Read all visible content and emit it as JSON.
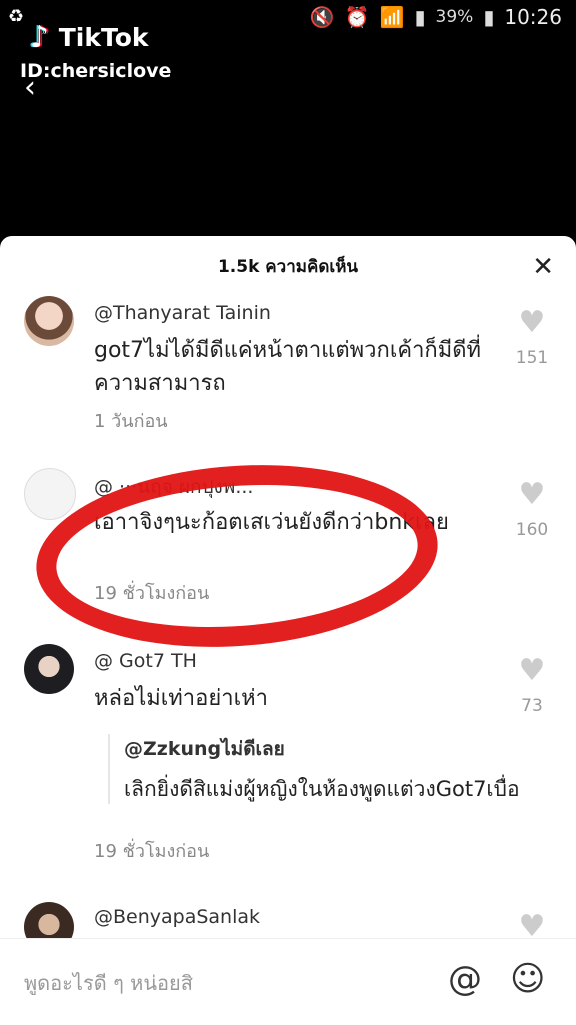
{
  "status": {
    "battery": "39%",
    "time": "10:26"
  },
  "watermark": {
    "app": "TikTok",
    "id": "ID:chersiclove"
  },
  "panel": {
    "title": "1.5k ความคิดเห็น"
  },
  "comments": [
    {
      "user": "@Thanyarat Tainin",
      "text": "got7ไม่ได้มีดีแค่หน้าตาแต่พวกเค้าก็มีดีที่ความสามารถ",
      "time": "1 วันก่อน",
      "likes": "151"
    },
    {
      "user": "@ ···นฤจ ผกปุงพ...",
      "text": "เอาาจิงๆนะก้อตเสเว่นยังดีกว่าbnkเลย",
      "time": "19 ชั่วโมงก่อน",
      "likes": "160"
    },
    {
      "user": "@ Got7 TH",
      "text": "หล่อไม่เท่าอย่าเห่า",
      "likes": "73",
      "reply": {
        "user": "@Zzkungไม่ดีเลย",
        "text": "เลิกยิ่งดีสิแม่งผู้หญิงในห้องพูดแต่วงGot7เบื่อ"
      },
      "time": "19 ชั่วโมงก่อน"
    },
    {
      "user": "@BenyapaSanlak"
    }
  ],
  "input": {
    "placeholder": "พูดอะไรดี ๆ หน่อยสิ"
  }
}
